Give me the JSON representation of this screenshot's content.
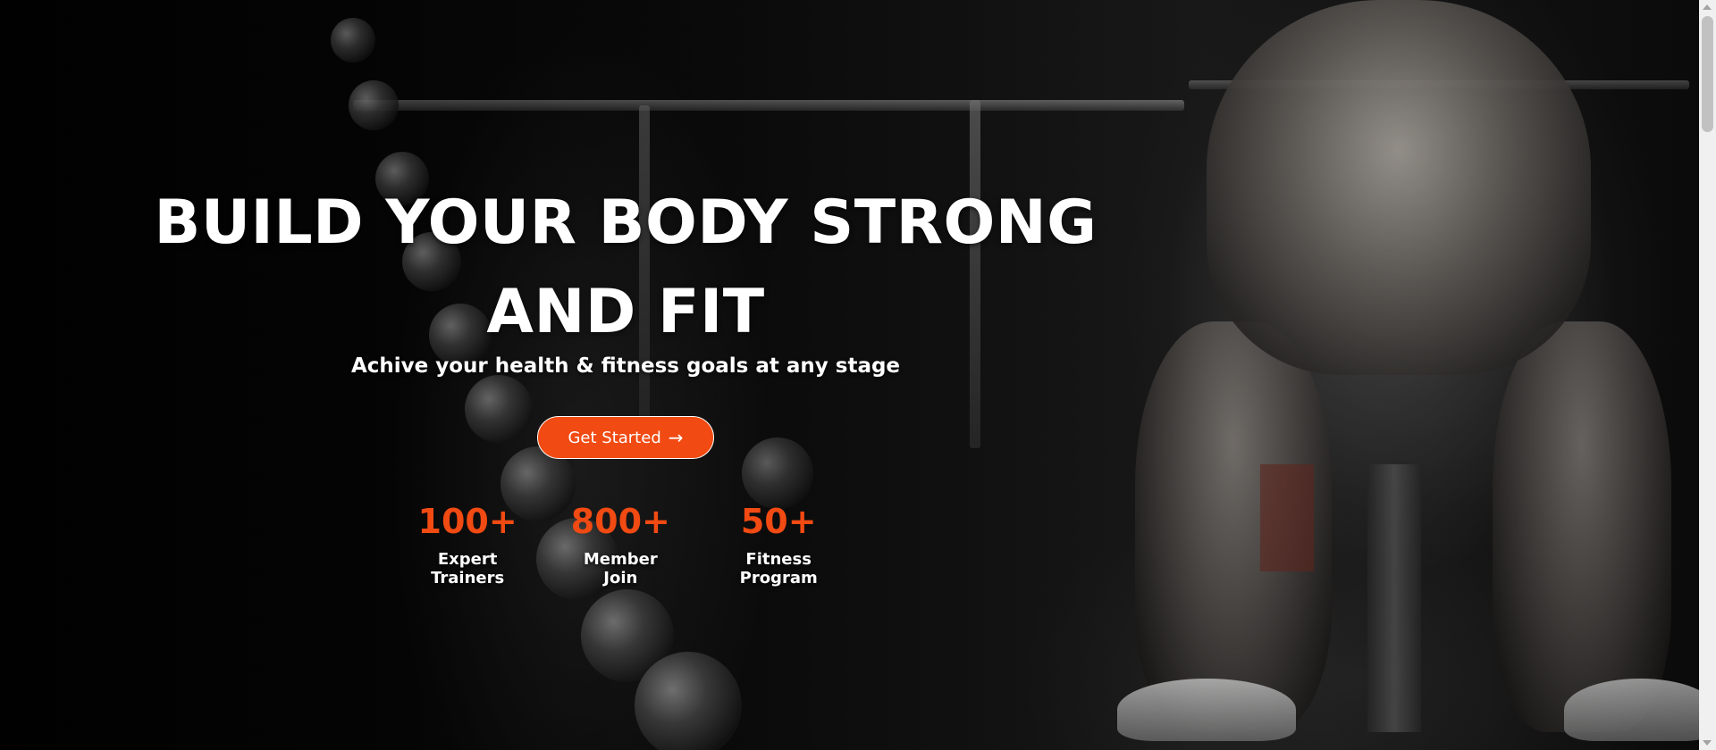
{
  "hero": {
    "headline_line1": "BUILD YOUR BODY STRONG",
    "headline_line2": "AND FIT",
    "subtitle": "Achive your health & fitness goals at any stage",
    "cta_label": "Get Started",
    "cta_icon": "arrow-right-icon"
  },
  "stats": [
    {
      "value": "100+",
      "label": "Expert Trainers"
    },
    {
      "value": "800+",
      "label": "Member Join"
    },
    {
      "value": "50+",
      "label": "Fitness Program"
    }
  ],
  "colors": {
    "accent": "#f14a12",
    "text": "#ffffff",
    "background": "#000000"
  }
}
